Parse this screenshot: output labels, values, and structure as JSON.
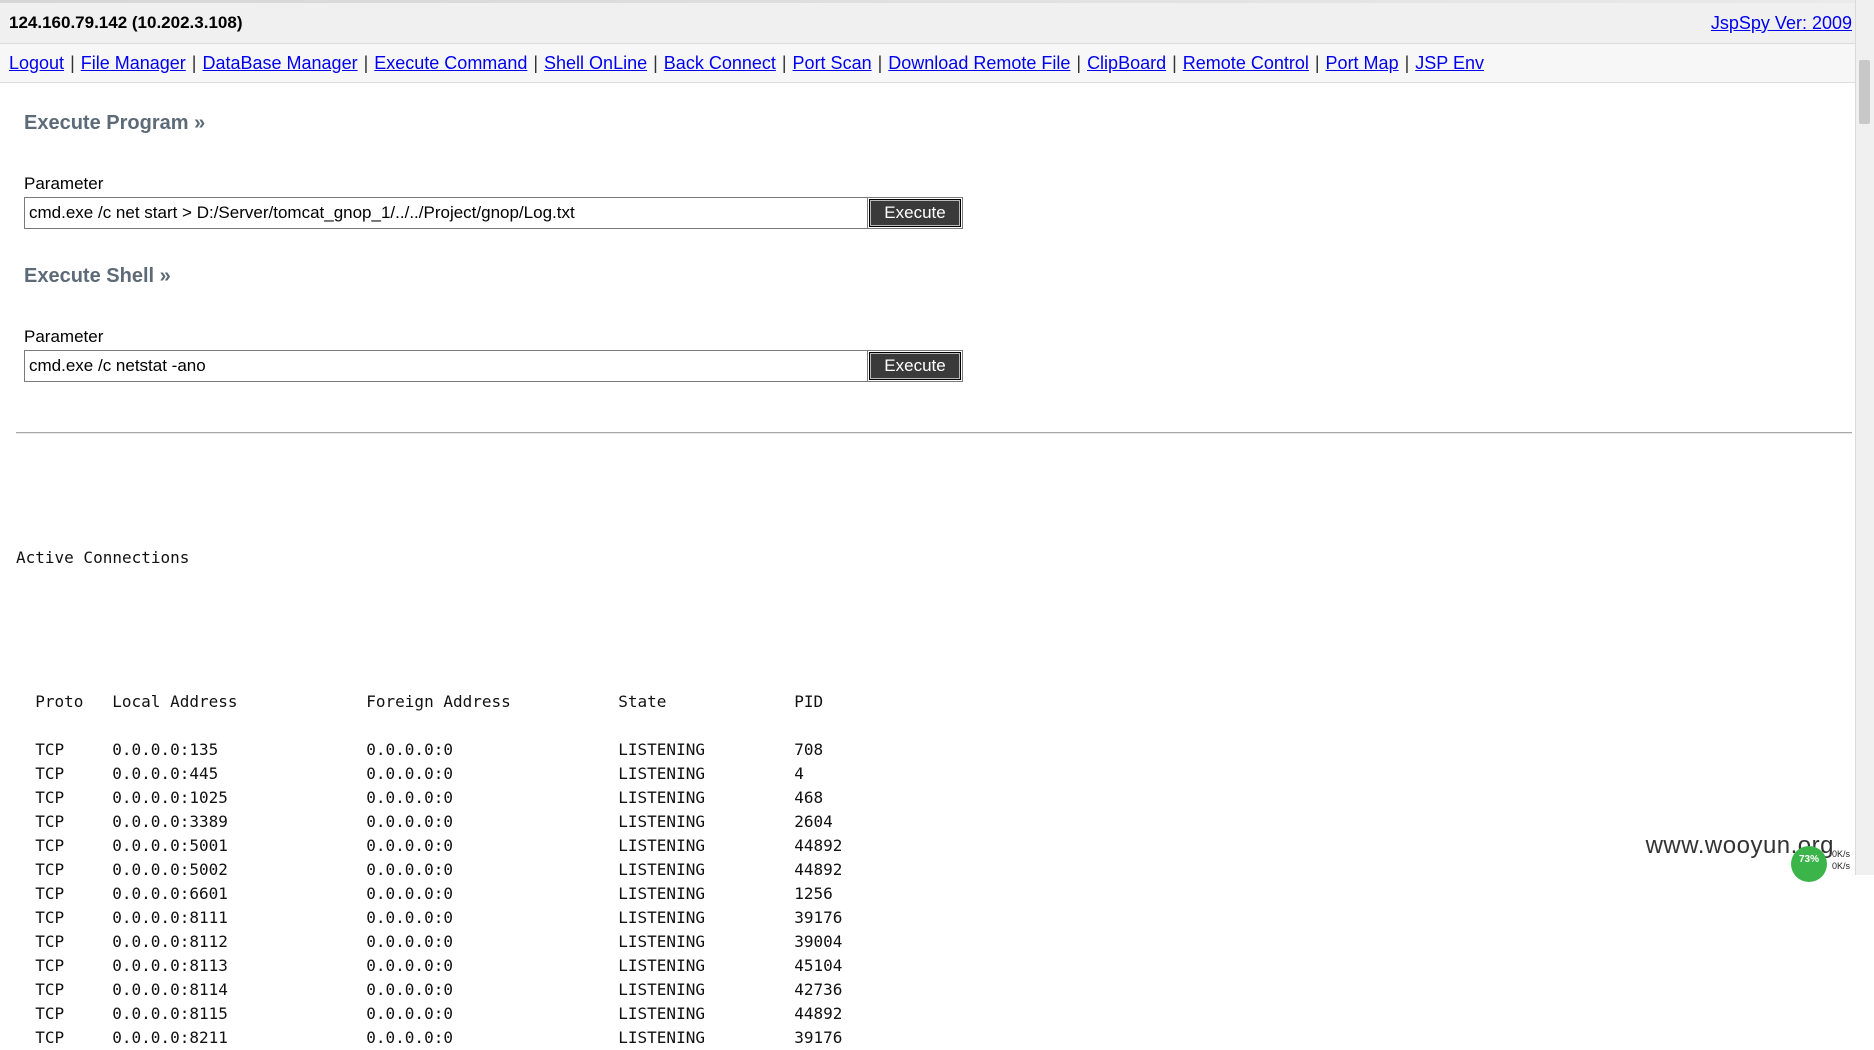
{
  "header": {
    "host": "124.160.79.142 (10.202.3.108)",
    "version_link": "JspSpy Ver: 2009"
  },
  "nav": {
    "items": [
      {
        "label": "Logout"
      },
      {
        "label": "File Manager"
      },
      {
        "label": "DataBase Manager"
      },
      {
        "label": "Execute Command"
      },
      {
        "label": "Shell OnLine"
      },
      {
        "label": "Back Connect"
      },
      {
        "label": "Port Scan"
      },
      {
        "label": "Download Remote File"
      },
      {
        "label": "ClipBoard"
      },
      {
        "label": "Remote Control"
      },
      {
        "label": "Port Map"
      },
      {
        "label": "JSP Env"
      }
    ],
    "separator": "|"
  },
  "program": {
    "title": "Execute Program »",
    "param_label": "Parameter",
    "value": "cmd.exe /c net start > D:/Server/tomcat_gnop_1/../../Project/gnop/Log.txt",
    "button": "Execute"
  },
  "shell": {
    "title": "Execute Shell »",
    "param_label": "Parameter",
    "value": "cmd.exe /c netstat -ano",
    "button": "Execute"
  },
  "output": {
    "heading": "Active Connections",
    "columns": [
      "Proto",
      "Local Address",
      "Foreign Address",
      "State",
      "PID"
    ],
    "rows": [
      [
        "TCP",
        "0.0.0.0:135",
        "0.0.0.0:0",
        "LISTENING",
        "708"
      ],
      [
        "TCP",
        "0.0.0.0:445",
        "0.0.0.0:0",
        "LISTENING",
        "4"
      ],
      [
        "TCP",
        "0.0.0.0:1025",
        "0.0.0.0:0",
        "LISTENING",
        "468"
      ],
      [
        "TCP",
        "0.0.0.0:3389",
        "0.0.0.0:0",
        "LISTENING",
        "2604"
      ],
      [
        "TCP",
        "0.0.0.0:5001",
        "0.0.0.0:0",
        "LISTENING",
        "44892"
      ],
      [
        "TCP",
        "0.0.0.0:5002",
        "0.0.0.0:0",
        "LISTENING",
        "44892"
      ],
      [
        "TCP",
        "0.0.0.0:6601",
        "0.0.0.0:0",
        "LISTENING",
        "1256"
      ],
      [
        "TCP",
        "0.0.0.0:8111",
        "0.0.0.0:0",
        "LISTENING",
        "39176"
      ],
      [
        "TCP",
        "0.0.0.0:8112",
        "0.0.0.0:0",
        "LISTENING",
        "39004"
      ],
      [
        "TCP",
        "0.0.0.0:8113",
        "0.0.0.0:0",
        "LISTENING",
        "45104"
      ],
      [
        "TCP",
        "0.0.0.0:8114",
        "0.0.0.0:0",
        "LISTENING",
        "42736"
      ],
      [
        "TCP",
        "0.0.0.0:8115",
        "0.0.0.0:0",
        "LISTENING",
        "44892"
      ],
      [
        "TCP",
        "0.0.0.0:8211",
        "0.0.0.0:0",
        "LISTENING",
        "39176"
      ]
    ]
  },
  "watermark": "www.wooyun.org",
  "tray": {
    "percent": "73%",
    "up_rate": "0K/s",
    "down_rate": "0K/s",
    "badge_color": "#3bb54a"
  }
}
